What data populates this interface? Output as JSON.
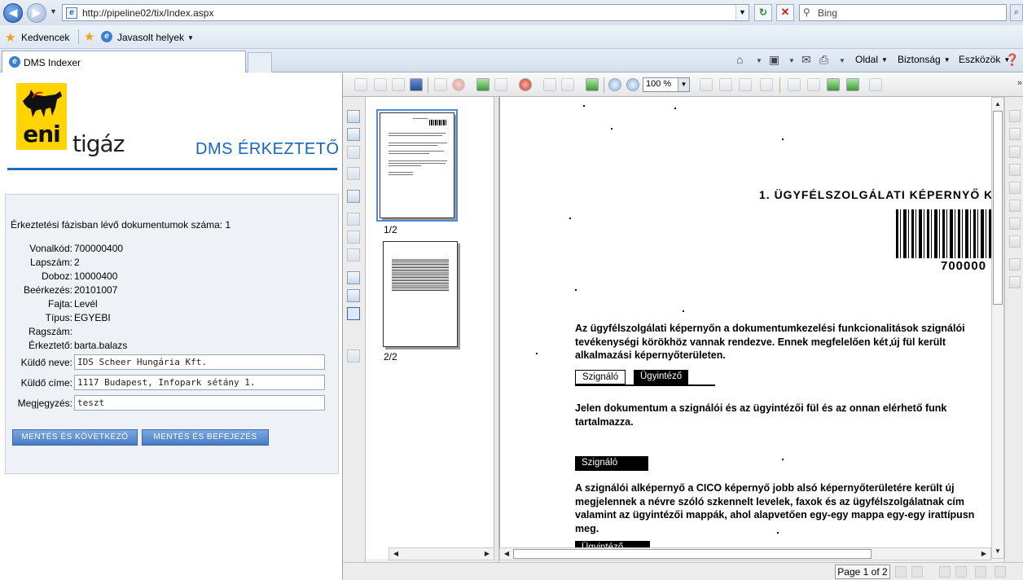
{
  "browser": {
    "address": "http://pipeline02/tix/Index.aspx",
    "search_placeholder": "Bing",
    "favorites_label": "Kedvencek",
    "suggested_sites": "Javasolt helyek",
    "tab_title": "DMS Indexer",
    "commands": {
      "page": "Oldal",
      "safety": "Biztonság",
      "tools": "Eszközök"
    }
  },
  "app": {
    "brand_logo_text": "eni",
    "brand_name": "tigáz",
    "title": "DMS ÉRKEZTETŐ"
  },
  "form": {
    "count_line": "Érkeztetési fázisban lévő dokumentumok száma: 1",
    "fields": [
      {
        "label": "Vonalkód:",
        "value": "700000400"
      },
      {
        "label": "Lapszám:",
        "value": "2"
      },
      {
        "label": "Doboz:",
        "value": "10000400"
      },
      {
        "label": "Beérkezés:",
        "value": "20101007"
      },
      {
        "label": "Fajta:",
        "value": "Levél"
      },
      {
        "label": "Típus:",
        "value": "EGYEBI"
      },
      {
        "label": "Ragszám:",
        "value": ""
      },
      {
        "label": "Érkeztető:",
        "value": "barta.balazs"
      }
    ],
    "inputs": {
      "sender_name": {
        "label": "Küldő neve:",
        "value": "IDS Scheer Hungária Kft."
      },
      "sender_address": {
        "label": "Küldő címe:",
        "value": "1117 Budapest, Infopark sétány 1."
      },
      "note": {
        "label": "Megjegyzés:",
        "value": "teszt"
      }
    },
    "buttons": {
      "save_next": "MENTÉS ÉS KÖVETKEZŐ",
      "save_finish": "MENTÉS ÉS BEFEJEZÉS"
    }
  },
  "viewer": {
    "zoom": "100 %",
    "thumbnails": [
      {
        "label": "1/2"
      },
      {
        "label": "2/2"
      }
    ],
    "page_indicator": "Page 1 of 2",
    "document": {
      "heading": "1. ÜGYFÉLSZOLGÁLATI KÉPERNYŐ K",
      "barcode_number": "700000",
      "para1": [
        "Az ügyfélszolgálati képernyőn a dokumentumkezelési funkcionalitások szignálói",
        "tevékenységi körökhöz vannak rendezve. Ennek megfelelően két új fül került",
        "alkalmazási képernyőterületen."
      ],
      "tab_szignalo": "Szignáló",
      "tab_ugyintezo": "Ügyintéző",
      "para2": [
        "Jelen dokumentum a szignálói és az ügyintézői fül és az onnan elérhető funk",
        "tartalmazza."
      ],
      "tab_szignalo2": "Szignáló",
      "para3": [
        "A szignálói alképernyő a CICO képernyő jobb alsó képernyőterületére került új",
        "megjelennek a névre szóló szkennelt levelek, faxok és az ügyfélszolgálatnak cím",
        "valamint az ügyintézői mappák, ahol alapvetően egy-egy mappa egy-egy irattípusn",
        "meg."
      ],
      "tab_ugyintezo2": "Ügyintéző"
    }
  }
}
